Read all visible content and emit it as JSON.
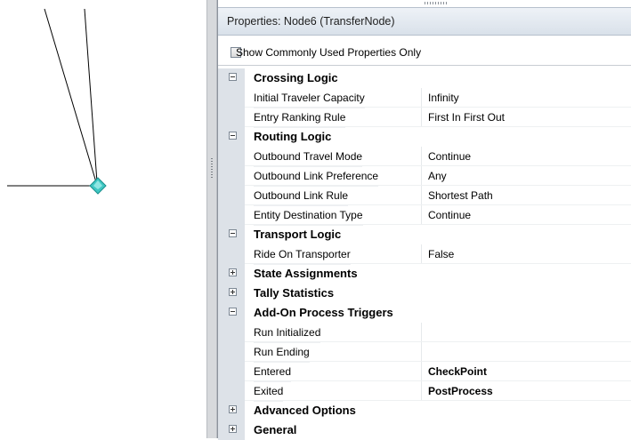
{
  "panel": {
    "title": "Properties: Node6 (TransferNode)",
    "filter_label": "Show Commonly Used Properties Only"
  },
  "rows": [
    {
      "type": "category",
      "label": "Crossing Logic",
      "expanded": true
    },
    {
      "type": "property",
      "name": "Initial Traveler Capacity",
      "value": "Infinity"
    },
    {
      "type": "property",
      "name": "Entry Ranking Rule",
      "value": "First In First Out"
    },
    {
      "type": "category",
      "label": "Routing Logic",
      "expanded": true
    },
    {
      "type": "property",
      "name": "Outbound Travel Mode",
      "value": "Continue"
    },
    {
      "type": "property",
      "name": "Outbound Link Preference",
      "value": "Any"
    },
    {
      "type": "property",
      "name": "Outbound Link Rule",
      "value": "Shortest Path"
    },
    {
      "type": "property",
      "name": "Entity Destination Type",
      "value": "Continue"
    },
    {
      "type": "category",
      "label": "Transport Logic",
      "expanded": true
    },
    {
      "type": "property",
      "name": "Ride On Transporter",
      "value": "False"
    },
    {
      "type": "category",
      "label": "State Assignments",
      "expanded": false
    },
    {
      "type": "category",
      "label": "Tally Statistics",
      "expanded": false
    },
    {
      "type": "category",
      "label": "Add-On Process Triggers",
      "expanded": true
    },
    {
      "type": "property",
      "name": "Run Initialized",
      "value": ""
    },
    {
      "type": "property",
      "name": "Run Ending",
      "value": ""
    },
    {
      "type": "property",
      "name": "Entered",
      "value": "CheckPoint",
      "bold": true
    },
    {
      "type": "property",
      "name": "Exited",
      "value": "PostProcess",
      "bold": true
    },
    {
      "type": "category",
      "label": "Advanced Options",
      "expanded": false
    },
    {
      "type": "category",
      "label": "General",
      "expanded": false
    }
  ],
  "colors": {
    "node": "#3fc7c3",
    "gutter": "#dde2e8",
    "header": "#d9e1ea"
  },
  "icons": {
    "node": "transfer-node-diamond-icon",
    "collapse": "minus-box-icon",
    "expand": "plus-box-icon"
  }
}
